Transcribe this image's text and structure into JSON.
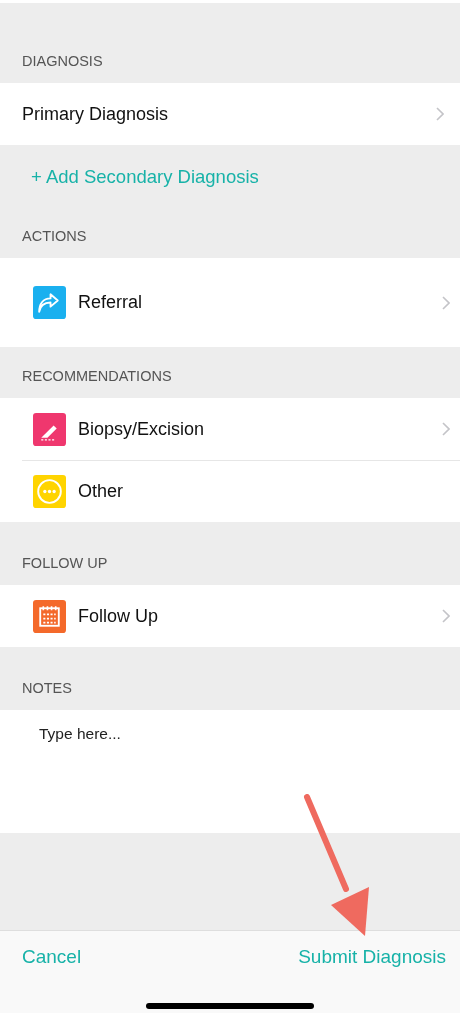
{
  "diagnosis": {
    "header": "DIAGNOSIS",
    "primary": {
      "label": "Primary Diagnosis",
      "chevron": true
    },
    "add_link": "+ Add Secondary Diagnosis"
  },
  "sections": [
    {
      "header": "ACTIONS",
      "rows": [
        {
          "label": "Referral",
          "kind": "share",
          "color": "#1ab0ef",
          "chevron": true
        }
      ]
    },
    {
      "header": "RECOMMENDATIONS",
      "rows": [
        {
          "label": "Biopsy/Excision",
          "kind": "scalpel",
          "color": "#ef376e",
          "chevron": true
        },
        {
          "label": "Other",
          "kind": "more",
          "color": "#ffd400",
          "chevron": false
        }
      ]
    },
    {
      "header": "FOLLOW UP",
      "rows": [
        {
          "label": "Follow Up",
          "kind": "calendar",
          "color": "#f4692a",
          "chevron": true
        }
      ]
    }
  ],
  "notes": {
    "header": "NOTES",
    "placeholder": "Type here..."
  },
  "footer": {
    "cancel": "Cancel",
    "submit": "Submit Diagnosis"
  }
}
